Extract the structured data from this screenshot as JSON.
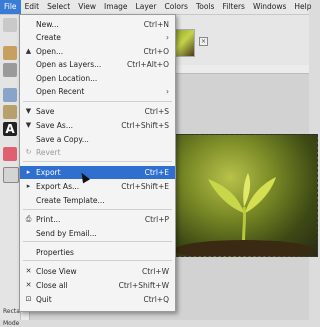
{
  "menubar": [
    "File",
    "Edit",
    "Select",
    "View",
    "Image",
    "Layer",
    "Colors",
    "Tools",
    "Filters",
    "Windows",
    "Help"
  ],
  "menu": {
    "items": [
      {
        "label": "New...",
        "shortcut": "Ctrl+N",
        "icon": "new-icon",
        "glyph": ""
      },
      {
        "label": "Create",
        "shortcut": "",
        "icon": "",
        "glyph": "",
        "submenu": true
      },
      {
        "label": "Open...",
        "shortcut": "Ctrl+O",
        "icon": "open-icon",
        "glyph": "▲"
      },
      {
        "label": "Open as Layers...",
        "shortcut": "Ctrl+Alt+O",
        "icon": "",
        "glyph": ""
      },
      {
        "label": "Open Location...",
        "shortcut": "",
        "icon": "",
        "glyph": ""
      },
      {
        "label": "Open Recent",
        "shortcut": "",
        "icon": "",
        "glyph": "",
        "submenu": true
      },
      {
        "label": "Save",
        "shortcut": "Ctrl+S",
        "icon": "save-icon",
        "glyph": "▼"
      },
      {
        "label": "Save As...",
        "shortcut": "Ctrl+Shift+S",
        "icon": "save-as-icon",
        "glyph": "▼"
      },
      {
        "label": "Save a Copy...",
        "shortcut": "",
        "icon": "",
        "glyph": ""
      },
      {
        "label": "Revert",
        "shortcut": "",
        "icon": "revert-icon",
        "glyph": "↻",
        "disabled": true
      },
      {
        "label": "Export",
        "shortcut": "Ctrl+E",
        "icon": "export-icon",
        "glyph": "▸",
        "selected": true
      },
      {
        "label": "Export As...",
        "shortcut": "Ctrl+Shift+E",
        "icon": "export-as-icon",
        "glyph": "▸"
      },
      {
        "label": "Create Template...",
        "shortcut": "",
        "icon": "",
        "glyph": ""
      },
      {
        "label": "Print...",
        "shortcut": "Ctrl+P",
        "icon": "print-icon",
        "glyph": "⎙"
      },
      {
        "label": "Send by Email...",
        "shortcut": "",
        "icon": "",
        "glyph": ""
      },
      {
        "label": "Properties",
        "shortcut": "",
        "icon": "",
        "glyph": ""
      },
      {
        "label": "Close View",
        "shortcut": "Ctrl+W",
        "icon": "close-icon",
        "glyph": "✕"
      },
      {
        "label": "Close all",
        "shortcut": "Ctrl+Shift+W",
        "icon": "close-all-icon",
        "glyph": "✕"
      },
      {
        "label": "Quit",
        "shortcut": "Ctrl+Q",
        "icon": "quit-icon",
        "glyph": "⊡"
      }
    ]
  },
  "toolbox": {
    "options_title": "Recta",
    "options_mode": "Mode"
  },
  "tab": {
    "close_glyph": "×"
  },
  "colors": {
    "selected": "#2f6fd0",
    "menubar_active": "#3a7bd5"
  }
}
